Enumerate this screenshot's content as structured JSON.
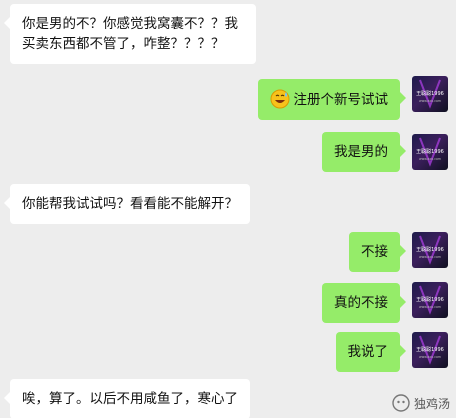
{
  "messages": [
    {
      "side": "left",
      "text": "你是男的不？你感觉我窝囊不？？我买卖东西都不管了，咋整？？？？"
    },
    {
      "side": "right",
      "text": "注册个新号试试",
      "emoji": "grinning-sweat-face-icon"
    },
    {
      "side": "right",
      "text": "我是男的"
    },
    {
      "side": "left",
      "text": "你能帮我试试吗？看看能不能解开？"
    },
    {
      "side": "right",
      "text": "不接"
    },
    {
      "side": "right",
      "text": "真的不接"
    },
    {
      "side": "right",
      "text": "我说了"
    },
    {
      "side": "left",
      "text": "唉，算了。以后不用咸鱼了，寒心了"
    }
  ],
  "avatar": {
    "line1": "王聪聪1996",
    "line2": "www.xxx.com"
  },
  "watermark": {
    "text": "独鸡汤",
    "icon": "wechat-channel-icon"
  },
  "colors": {
    "background": "#ededed",
    "bubble_left": "#ffffff",
    "bubble_right": "#95ec69",
    "text": "#111111"
  }
}
